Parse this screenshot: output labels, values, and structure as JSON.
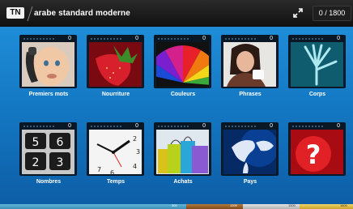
{
  "app": {
    "logo_text": "TN",
    "title": "arabe standard moderne",
    "counter": "0 / 1800"
  },
  "tiles": [
    {
      "label": "Premiers mots",
      "count": "0",
      "image": "baby-on-phone"
    },
    {
      "label": "Nourriture",
      "count": "0",
      "image": "strawberries"
    },
    {
      "label": "Couleurs",
      "count": "0",
      "image": "color-wheel"
    },
    {
      "label": "Phrases",
      "count": "0",
      "image": "woman-with-cup"
    },
    {
      "label": "Corps",
      "count": "0",
      "image": "hand-xray"
    },
    {
      "label": "Nombres",
      "count": "0",
      "image": "calculator-keys"
    },
    {
      "label": "Temps",
      "count": "0",
      "image": "clock"
    },
    {
      "label": "Achats",
      "count": "0",
      "image": "shopping-bags"
    },
    {
      "label": "Pays",
      "count": "0",
      "image": "world-map"
    },
    {
      "label": "",
      "count": "0",
      "image": "question-mark"
    }
  ],
  "bottom_bar": {
    "segments": [
      "300",
      "1200",
      "1500",
      "1800"
    ]
  },
  "colors": {
    "background_top": "#1f8dd8",
    "background_bottom": "#0d5ea6",
    "topbar": "#151515",
    "tile_header": "#0a1826"
  }
}
